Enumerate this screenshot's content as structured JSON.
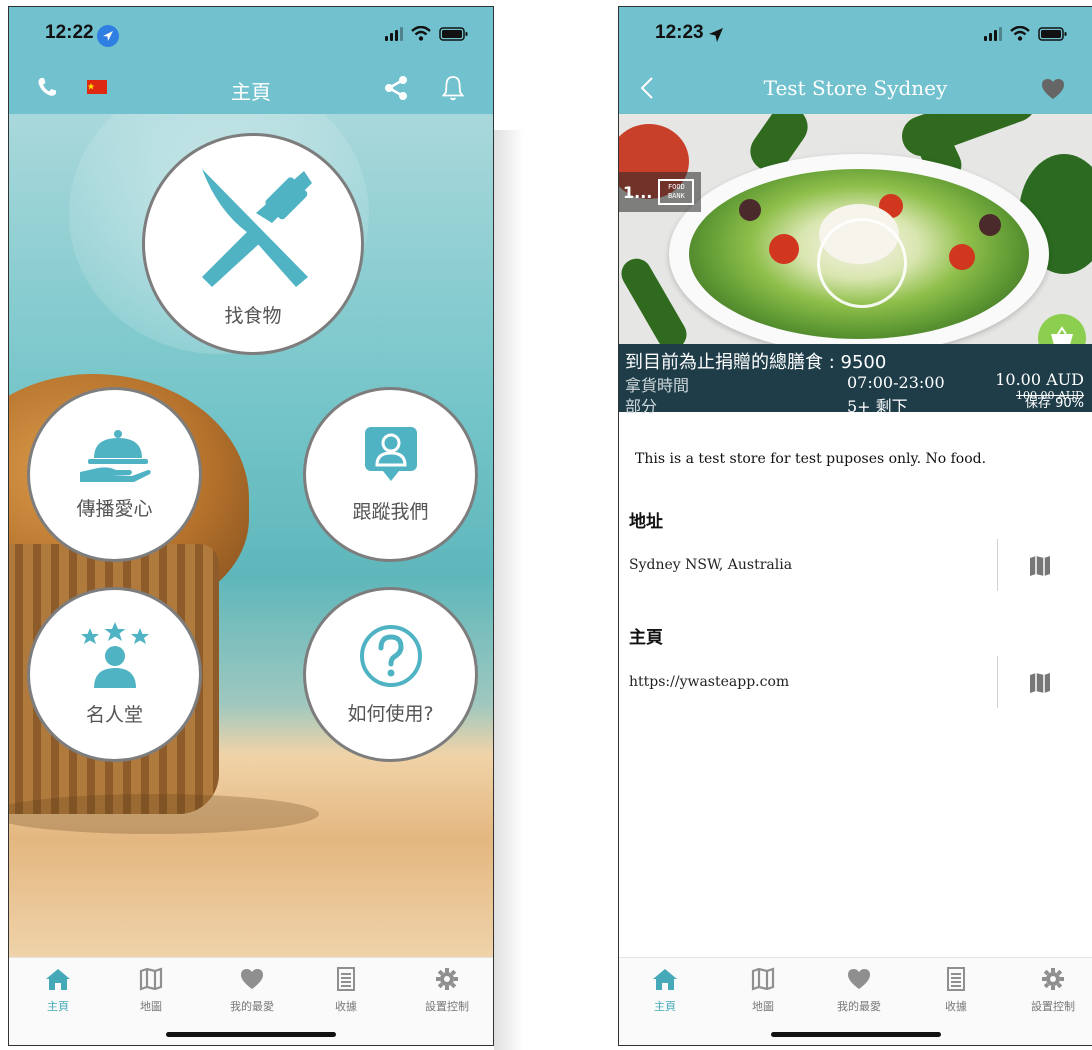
{
  "left_screen": {
    "status": {
      "time": "12:22"
    },
    "nav": {
      "title": "主頁"
    },
    "buttons": {
      "find_food": "找食物",
      "spread_love": "傳播愛心",
      "follow_us": "跟蹤我們",
      "hall_of_fame": "名人堂",
      "how_to_use": "如何使用?"
    }
  },
  "right_screen": {
    "status": {
      "time": "12:23"
    },
    "nav": {
      "title": "Test Store Sydney"
    },
    "badge": {
      "count": "1...",
      "logo_text": "FOOD BANK"
    },
    "info": {
      "donated_label": "到目前為止捐贈的總膳食 : 9500",
      "pickup_label": "拿貨時間",
      "pickup_value": "07:00-23:00",
      "portion_label": "部分",
      "portion_value": "5+ 剩下",
      "price": "10.00 AUD",
      "original_price": "100.00 AUD",
      "save": "保存 90%"
    },
    "description": "This is a test store for test puposes only. No food.",
    "address": {
      "title": "地址",
      "value": "Sydney NSW, Australia"
    },
    "homepage": {
      "title": "主頁",
      "value": "https://ywasteapp.com"
    }
  },
  "tabbar": {
    "tabs": [
      {
        "label": "主頁",
        "icon": "home-icon",
        "active": true
      },
      {
        "label": "地圖",
        "icon": "map-icon"
      },
      {
        "label": "我的最愛",
        "icon": "heart-icon"
      },
      {
        "label": "收據",
        "icon": "receipt-icon"
      },
      {
        "label": "設置控制",
        "icon": "gear-icon"
      }
    ]
  },
  "colors": {
    "teal": "#72c1ce",
    "icon_teal": "#4fb3c3",
    "info_panel": "#1e3d49",
    "cart_green": "#8ccf4e",
    "circle_border": "#7d7d7d"
  }
}
